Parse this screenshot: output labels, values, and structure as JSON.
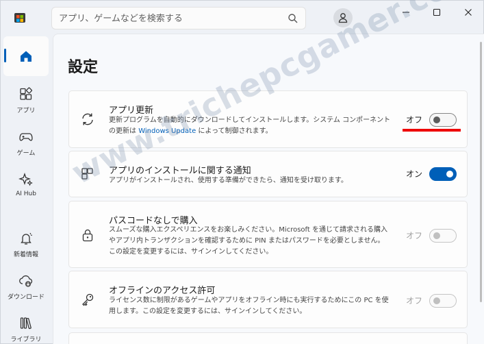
{
  "titlebar": {
    "search_placeholder": "アプリ、ゲームなどを検索する",
    "icons": {
      "logo": "store-logo-icon",
      "search": "search-icon",
      "avatar": "user-icon"
    },
    "window_buttons": [
      "minimize",
      "maximize",
      "close"
    ]
  },
  "sidebar": {
    "items": [
      {
        "label": "",
        "icon": "home-icon",
        "active": true
      },
      {
        "label": "アプリ",
        "icon": "apps-icon"
      },
      {
        "label": "ゲーム",
        "icon": "gamepad-icon"
      },
      {
        "label": "AI Hub",
        "icon": "sparkle-icon"
      },
      {
        "label": "新着情報",
        "icon": "bell-icon"
      },
      {
        "label": "ダウンロード",
        "icon": "download-icon"
      },
      {
        "label": "ライブラリ",
        "icon": "library-icon"
      }
    ]
  },
  "page": {
    "title": "設定"
  },
  "settings": [
    {
      "title": "アプリ更新",
      "desc_before": "更新プログラムを自動的にダウンロードしてインストールします。システム コンポーネントの更新は ",
      "desc_link": "Windows Update",
      "desc_after": " によって制御されます。",
      "state_label": "オフ",
      "on": false,
      "enabled": true,
      "icon": "sync-icon"
    },
    {
      "title": "アプリのインストールに関する通知",
      "desc": "アプリがインストールされ、使用する準備ができたら、通知を受け取ります。",
      "state_label": "オン",
      "on": true,
      "enabled": true,
      "icon": "app-blocks-icon"
    },
    {
      "title": "パスコードなしで購入",
      "desc": "スムーズな購入エクスペリエンスをお楽しみください。Microsoft を通じて請求される購入やアプリ内トランザクションを確認するために PIN またはパスワードを必要としません。この設定を変更するには、サインインしてください。",
      "state_label": "オフ",
      "on": false,
      "enabled": false,
      "icon": "lock-icon"
    },
    {
      "title": "オフラインのアクセス許可",
      "desc": "ライセンス数に制限があるゲームやアプリをオフライン時にも実行するためにこの PC を使用します。この設定を変更するには、サインインしてください。",
      "state_label": "オフ",
      "on": false,
      "enabled": false,
      "icon": "key-icon"
    }
  ],
  "watermark": "www.trichepcgamer.com",
  "colors": {
    "accent": "#005fb8",
    "highlight": "#ee0000"
  }
}
